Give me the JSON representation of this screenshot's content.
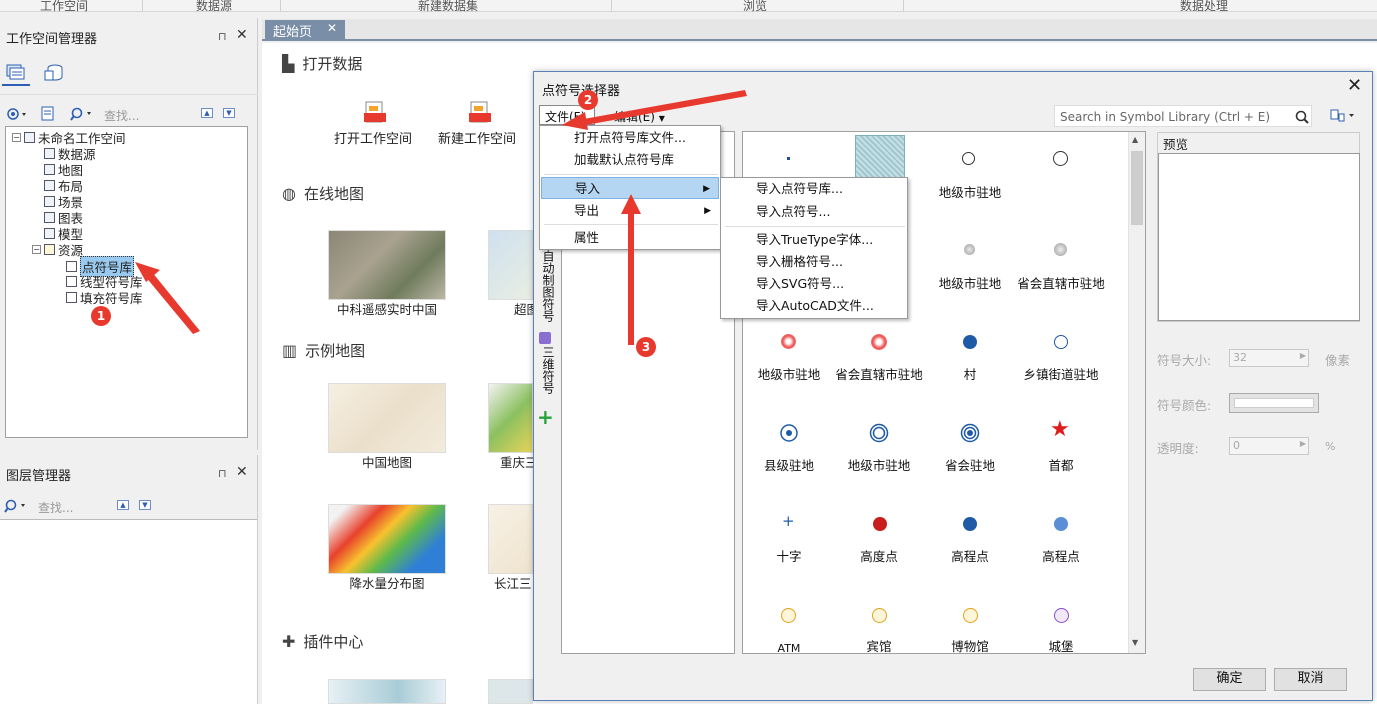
{
  "ribbon": {
    "tabs": [
      "工作空间",
      "数据源",
      "新建数据集",
      "浏览",
      "数据处理"
    ]
  },
  "workspace_panel": {
    "title": "工作空间管理器",
    "search_placeholder": "查找...",
    "tree": {
      "root": "未命名工作空间",
      "items": [
        "数据源",
        "地图",
        "布局",
        "场景",
        "图表",
        "模型",
        "资源"
      ],
      "resource_children": [
        "点符号库",
        "线型符号库",
        "填充符号库"
      ]
    }
  },
  "layer_panel": {
    "title": "图层管理器",
    "search_placeholder": "查找..."
  },
  "start_page": {
    "tab_label": "起始页",
    "open_data_title": "打开数据",
    "open_workspace": "打开工作空间",
    "new_workspace": "新建工作空间",
    "online_map_title": "在线地图",
    "online_maps": [
      "中科遥感实时中国",
      "超图"
    ],
    "example_map_title": "示例地图",
    "example_maps": [
      "中国地图",
      "重庆三",
      "降水量分布图",
      "长江三"
    ],
    "plugin_title": "插件中心"
  },
  "dialog": {
    "title": "点符号选择器",
    "menu_file": "文件(F)",
    "menu_edit": "编辑(E)",
    "search_placeholder": "Search in Symbol Library (Ctrl + E)",
    "side_tabs": [
      "自动制图符号",
      "三维符号"
    ],
    "symbols": [
      "",
      "",
      "地级市驻地",
      "",
      "",
      "",
      "地级市驻地",
      "省会直辖市驻地",
      "地级市驻地",
      "省会直辖市驻地",
      "村",
      "乡镇街道驻地",
      "县级驻地",
      "地级市驻地",
      "省会驻地",
      "首都",
      "十字",
      "高度点",
      "高程点",
      "高程点",
      "ATM",
      "宾馆",
      "博物馆",
      "城堡"
    ],
    "preview_label": "预览",
    "size_label": "符号大小:",
    "size_value": "32",
    "size_unit": "像素",
    "color_label": "符号颜色:",
    "opacity_label": "透明度:",
    "opacity_value": "0",
    "opacity_unit": "%",
    "ok": "确定",
    "cancel": "取消"
  },
  "file_menu": {
    "items": [
      "打开点符号库文件...",
      "加载默认点符号库",
      "导入",
      "导出",
      "属性"
    ]
  },
  "import_submenu": {
    "items": [
      "导入点符号库...",
      "导入点符号...",
      "导入TrueType字体...",
      "导入栅格符号...",
      "导入SVG符号...",
      "导入AutoCAD文件..."
    ]
  },
  "annotations": [
    "1",
    "2",
    "3"
  ],
  "colors": {
    "accent_blue": "#1f5aa6",
    "red_marker": "#e8392f",
    "menu_highlight": "#b5d6f3"
  }
}
